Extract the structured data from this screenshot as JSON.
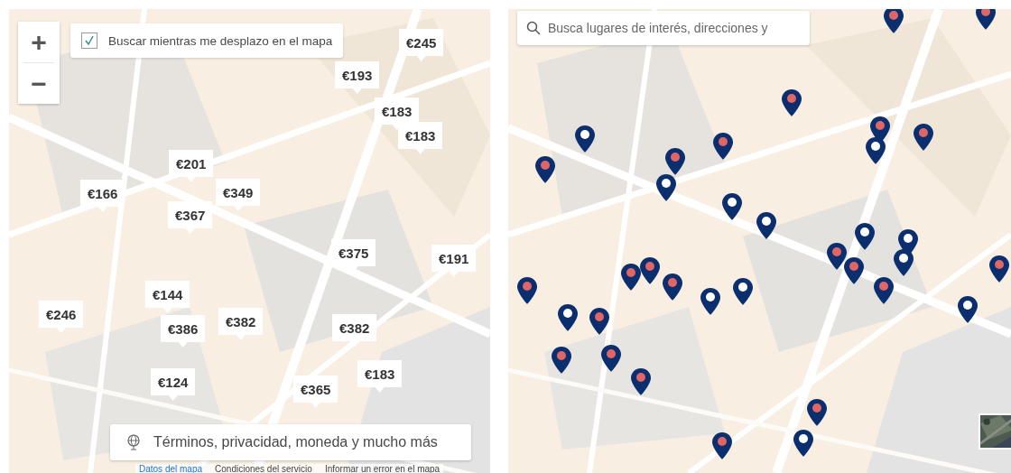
{
  "left_map": {
    "zoom_in": "+",
    "zoom_out": "−",
    "search_as_move": {
      "label": "Buscar mientras me desplazo en el mapa",
      "checked": true
    },
    "price_markers": [
      {
        "price": "€245"
      },
      {
        "price": "€193"
      },
      {
        "price": "€183"
      },
      {
        "price": "€183"
      },
      {
        "price": "€201"
      },
      {
        "price": "€166"
      },
      {
        "price": "€349"
      },
      {
        "price": "€367"
      },
      {
        "price": "€375"
      },
      {
        "price": "€191"
      },
      {
        "price": "€246"
      },
      {
        "price": "€144"
      },
      {
        "price": "€386"
      },
      {
        "price": "€382"
      },
      {
        "price": "€382"
      },
      {
        "price": "€124"
      },
      {
        "price": "€365"
      },
      {
        "price": "€183"
      }
    ],
    "terms_button": "Términos, privacidad, moneda y mucho más",
    "footer_links": [
      "Datos del mapa",
      "Condiciones del servicio",
      "Informar un error en el mapa"
    ]
  },
  "right_map": {
    "search": {
      "placeholder": "Busca lugares de interés, direcciones y"
    },
    "pins": [
      {
        "color": "#e06666"
      },
      {
        "color": "#ffffff"
      },
      {
        "color": "#e06666"
      },
      {
        "color": "#e06666"
      },
      {
        "color": "#ffffff"
      },
      {
        "color": "#ffffff"
      },
      {
        "color": "#ffffff"
      },
      {
        "color": "#e06666"
      },
      {
        "color": "#e06666"
      },
      {
        "color": "#ffffff"
      },
      {
        "color": "#e06666"
      },
      {
        "color": "#ffffff"
      },
      {
        "color": "#e06666"
      },
      {
        "color": "#e06666"
      },
      {
        "color": "#ffffff"
      },
      {
        "color": "#ffffff"
      },
      {
        "color": "#e06666"
      },
      {
        "color": "#e06666"
      },
      {
        "color": "#ffffff"
      },
      {
        "color": "#e06666"
      },
      {
        "color": "#e06666"
      },
      {
        "color": "#e06666"
      },
      {
        "color": "#e06666"
      },
      {
        "color": "#ffffff"
      },
      {
        "color": "#ffffff"
      },
      {
        "color": "#ffffff"
      },
      {
        "color": "#e06666"
      },
      {
        "color": "#e06666"
      },
      {
        "color": "#e06666"
      },
      {
        "color": "#e06666"
      },
      {
        "color": "#e06666"
      },
      {
        "color": "#ffffff"
      },
      {
        "color": "#e06666"
      },
      {
        "color": "#e06666"
      },
      {
        "color": "#e06666"
      }
    ]
  }
}
